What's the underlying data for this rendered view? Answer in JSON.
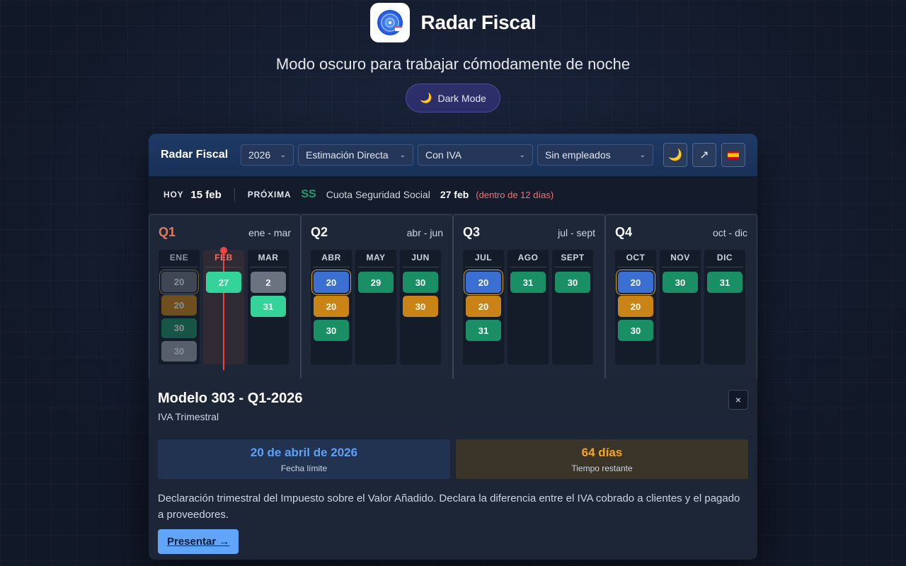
{
  "hero": {
    "title": "Radar Fiscal",
    "subtitle": "Modo oscuro para trabajar cómodamente de noche",
    "pill_icon": "moon-icon",
    "pill_label": "Dark Mode"
  },
  "toolbar": {
    "title": "Radar Fiscal",
    "selects": [
      {
        "value": "2026"
      },
      {
        "value": "Estimación Directa"
      },
      {
        "value": "Con IVA"
      },
      {
        "value": "Sin empleados"
      }
    ],
    "buttons": [
      {
        "icon": "moon-icon",
        "glyph": "🌙"
      },
      {
        "icon": "external-link-icon",
        "glyph": "↗"
      },
      {
        "icon": "spain-flag-icon",
        "glyph": "🇪🇸"
      }
    ]
  },
  "today_bar": {
    "today_label": "HOY",
    "today_value": "15 feb",
    "next_label": "PRÓXIMA",
    "next_tag": "SS",
    "next_name": "Cuota Seguridad Social",
    "next_date": "27 feb",
    "next_remaining": "(dentro de 12 días)"
  },
  "quarters": [
    {
      "name": "Q1",
      "range": "ene - mar",
      "months": [
        {
          "label": "ENE",
          "chips": [
            "20",
            "20",
            "30",
            "30"
          ]
        },
        {
          "label": "FEB",
          "chips": [
            "27"
          ]
        },
        {
          "label": "MAR",
          "chips": [
            "2",
            "31"
          ]
        }
      ]
    },
    {
      "name": "Q2",
      "range": "abr - jun",
      "months": [
        {
          "label": "ABR",
          "chips": [
            "20",
            "20",
            "30"
          ]
        },
        {
          "label": "MAY",
          "chips": [
            "29"
          ]
        },
        {
          "label": "JUN",
          "chips": [
            "30",
            "30"
          ]
        }
      ]
    },
    {
      "name": "Q3",
      "range": "jul - sept",
      "months": [
        {
          "label": "JUL",
          "chips": [
            "20",
            "20",
            "31"
          ]
        },
        {
          "label": "AGO",
          "chips": [
            "31"
          ]
        },
        {
          "label": "SEPT",
          "chips": [
            "30"
          ]
        }
      ]
    },
    {
      "name": "Q4",
      "range": "oct - dic",
      "months": [
        {
          "label": "OCT",
          "chips": [
            "20",
            "20",
            "30"
          ]
        },
        {
          "label": "NOV",
          "chips": [
            "30"
          ]
        },
        {
          "label": "DIC",
          "chips": [
            "31"
          ]
        }
      ]
    }
  ],
  "detail": {
    "title": "Modelo 303 - Q1-2026",
    "subtitle": "IVA Trimestral",
    "close_glyph": "×",
    "deadline_value": "20 de abril de 2026",
    "deadline_label": "Fecha límite",
    "remaining_value": "64 días",
    "remaining_label": "Tiempo restante",
    "description": "Declaración trimestral del Impuesto sobre el Valor Añadido. Declara la diferencia entre el IVA cobrado a clientes y el pagado a proveedores.",
    "action_label": "Presentar →"
  },
  "colors": {
    "accent_blue": "#3b6fd1",
    "accent_amber": "#c98316",
    "accent_teal": "#1a8f65",
    "today_red": "#ef4444"
  }
}
